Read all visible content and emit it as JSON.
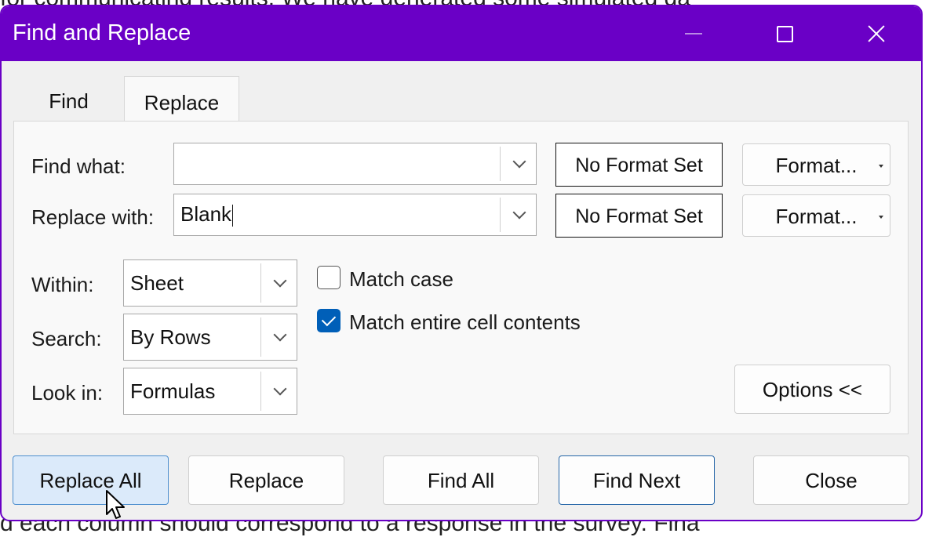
{
  "background": {
    "top_text": "for communicating results. We have generated some simulated da",
    "bottom_text": "d each column should correspond to a response in the survey. Fina"
  },
  "dialog": {
    "title": "Find and Replace",
    "accent_color": "#6a00c6",
    "tabs": [
      {
        "label": "Find",
        "selected": false
      },
      {
        "label": "Replace",
        "selected": true
      }
    ],
    "find_what": {
      "label": "Find what:",
      "value": "",
      "format_preview": "No Format Set",
      "format_button": "Format..."
    },
    "replace_with": {
      "label": "Replace with:",
      "value": "Blank",
      "format_preview": "No Format Set",
      "format_button": "Format..."
    },
    "within": {
      "label": "Within:",
      "value": "Sheet"
    },
    "search": {
      "label": "Search:",
      "value": "By Rows"
    },
    "look_in": {
      "label": "Look in:",
      "value": "Formulas"
    },
    "match_case": {
      "label": "Match case",
      "checked": false
    },
    "match_entire": {
      "label": "Match entire cell contents",
      "checked": true
    },
    "options_button": "Options <<",
    "buttons": {
      "replace_all": "Replace All",
      "replace": "Replace",
      "find_all": "Find All",
      "find_next": "Find Next",
      "close": "Close"
    }
  }
}
